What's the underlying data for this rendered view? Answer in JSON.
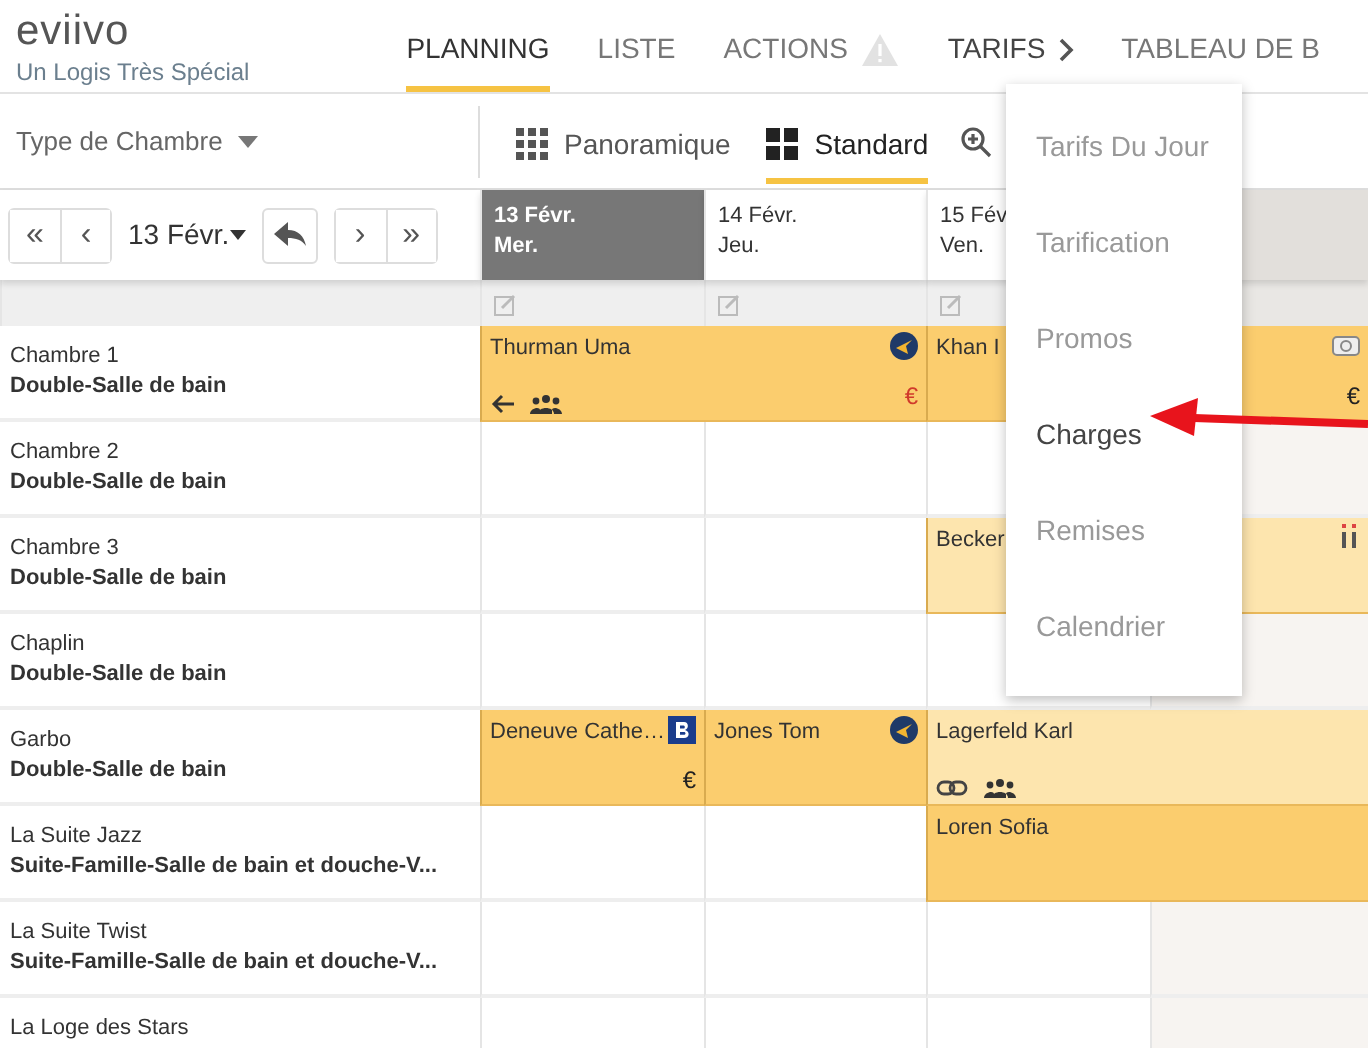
{
  "brand": {
    "logo": "eviivo",
    "subtitle": "Un Logis Très Spécial"
  },
  "nav_tabs": [
    {
      "label": "PLANNING",
      "selected": true,
      "kind": "plain"
    },
    {
      "label": "LISTE",
      "selected": false,
      "kind": "plain"
    },
    {
      "label": "ACTIONS",
      "selected": false,
      "kind": "warning"
    },
    {
      "label": "TARIFS",
      "selected": false,
      "kind": "submenu"
    },
    {
      "label": "TABLEAU DE B",
      "selected": false,
      "kind": "plain"
    }
  ],
  "room_filter": {
    "label": "Type de Chambre"
  },
  "view_modes": [
    {
      "label": "Panoramique",
      "selected": false,
      "kind": "grid"
    },
    {
      "label": "Standard",
      "selected": true,
      "kind": "tiles"
    }
  ],
  "date_nav": {
    "first": "«",
    "prev": "‹",
    "date": "13 Févr.",
    "next": "›",
    "last": "»"
  },
  "days": [
    {
      "date": "13 Févr.",
      "weekday": "Mer.",
      "selected": true,
      "shaded": false,
      "editable": true
    },
    {
      "date": "14 Févr.",
      "weekday": "Jeu.",
      "selected": false,
      "shaded": false,
      "editable": true
    },
    {
      "date": "15 Fév",
      "weekday": "Ven.",
      "selected": false,
      "shaded": false,
      "editable": true
    },
    {
      "selected": false,
      "shaded": true,
      "editable": false
    }
  ],
  "rooms": [
    {
      "name": "Chambre 1",
      "type": "Double-Salle de bain",
      "cells": [
        {
          "kind": "booking",
          "guest": "Thurman Uma",
          "pending": false,
          "icons": [
            {
              "kind": "globe"
            },
            {
              "kind": "arrow-left"
            },
            {
              "kind": "group"
            }
          ],
          "payment": {
            "text": "€",
            "due": true
          }
        },
        {
          "kind": "continued"
        },
        {
          "kind": "booking",
          "guest": "Khan I",
          "pending": false,
          "icons": [
            {
              "kind": "camera"
            }
          ],
          "payment": {
            "text": "€",
            "due": false
          }
        },
        {
          "kind": "continued"
        }
      ]
    },
    {
      "name": "Chambre 2",
      "type": "Double-Salle de bain",
      "cells": [
        {
          "kind": "free"
        },
        {
          "kind": "free"
        },
        {
          "kind": "free"
        },
        {
          "kind": "free"
        }
      ]
    },
    {
      "name": "Chambre 3",
      "type": "Double-Salle de bain",
      "cells": [
        {
          "kind": "free"
        },
        {
          "kind": "free"
        },
        {
          "kind": "booking",
          "guest": "Becker",
          "pending": true,
          "icons": [
            {
              "kind": "info"
            }
          ]
        },
        {
          "kind": "continued"
        }
      ]
    },
    {
      "name": "Chaplin",
      "type": "Double-Salle de bain",
      "cells": [
        {
          "kind": "free"
        },
        {
          "kind": "free"
        },
        {
          "kind": "free"
        },
        {
          "kind": "free"
        }
      ]
    },
    {
      "name": "Garbo",
      "type": "Double-Salle de bain",
      "cells": [
        {
          "kind": "booking",
          "guest": "Deneuve Cathe…",
          "pending": false,
          "icons": [
            {
              "kind": "letter-b"
            }
          ],
          "payment": {
            "text": "€",
            "due": false
          }
        },
        {
          "kind": "booking",
          "guest": "Jones Tom",
          "pending": false,
          "icons": [
            {
              "kind": "globe"
            }
          ]
        },
        {
          "kind": "booking",
          "guest": "Lagerfeld Karl",
          "pending": true,
          "icons": [
            {
              "kind": "link"
            },
            {
              "kind": "group"
            }
          ]
        },
        {
          "kind": "continued"
        }
      ]
    },
    {
      "name": "La Suite Jazz",
      "type": "Suite-Famille-Salle de bain et douche-V...",
      "cells": [
        {
          "kind": "free"
        },
        {
          "kind": "free"
        },
        {
          "kind": "booking",
          "guest": "Loren Sofia",
          "pending": false
        },
        {
          "kind": "continued"
        }
      ]
    },
    {
      "name": "La Suite Twist",
      "type": "Suite-Famille-Salle de bain et douche-V...",
      "cells": [
        {
          "kind": "free"
        },
        {
          "kind": "free"
        },
        {
          "kind": "free"
        },
        {
          "kind": "free"
        }
      ]
    },
    {
      "name": "La Loge des Stars",
      "cells": [
        {
          "kind": "free"
        },
        {
          "kind": "free"
        },
        {
          "kind": "free"
        },
        {
          "kind": "free"
        }
      ]
    }
  ],
  "tarifs_menu": {
    "items": [
      {
        "label": "Tarifs Du Jour",
        "highlighted": false
      },
      {
        "label": "Tarification",
        "highlighted": false
      },
      {
        "label": "Promos",
        "highlighted": false
      },
      {
        "label": "Charges",
        "highlighted": true
      },
      {
        "label": "Remises",
        "highlighted": false
      },
      {
        "label": "Calendrier",
        "highlighted": false
      }
    ]
  }
}
